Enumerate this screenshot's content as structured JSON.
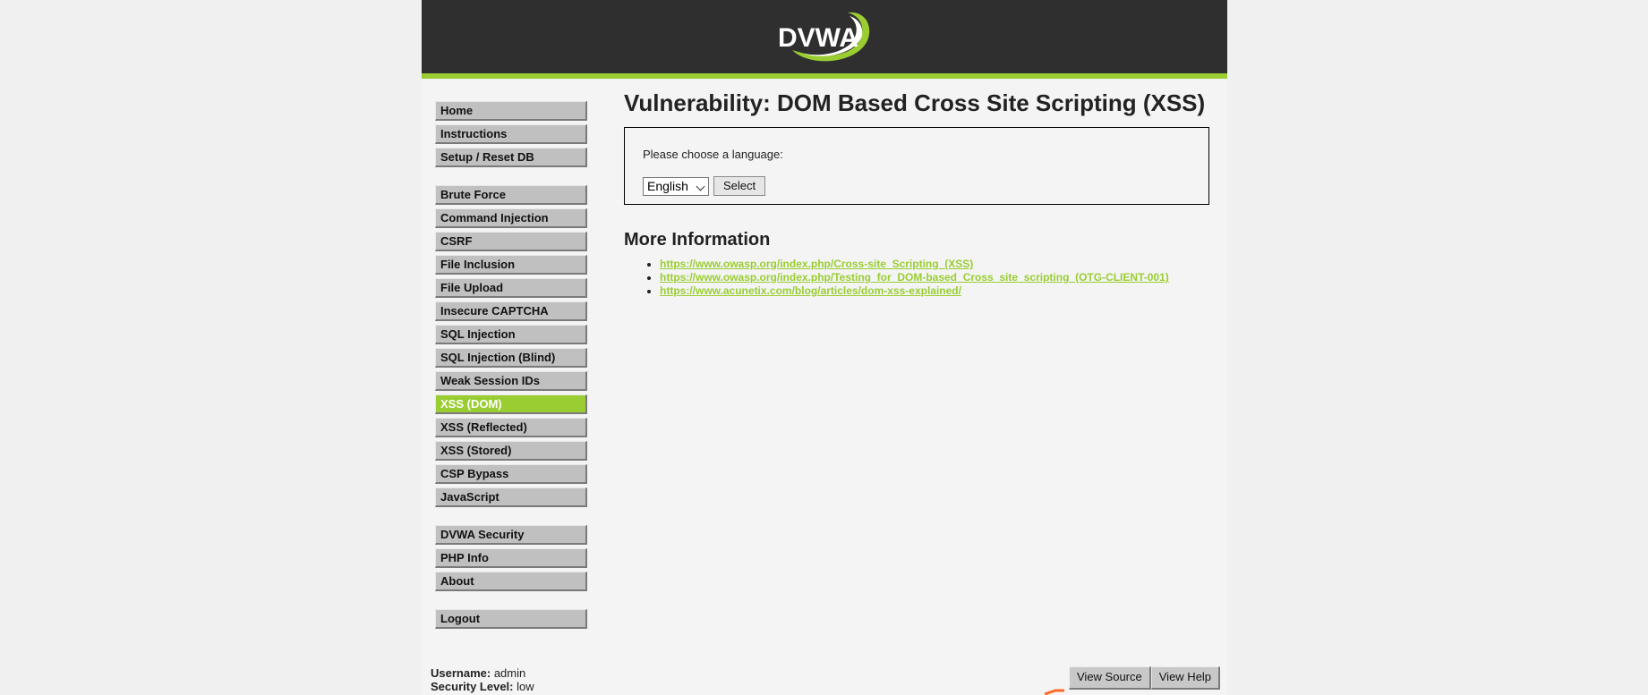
{
  "header": {
    "logo_text": "DVWA",
    "accent_color": "#9acd32",
    "background_color": "#2f2f2f"
  },
  "nav": {
    "groups": [
      {
        "items": [
          {
            "label": "Home"
          },
          {
            "label": "Instructions"
          },
          {
            "label": "Setup / Reset DB"
          }
        ]
      },
      {
        "items": [
          {
            "label": "Brute Force"
          },
          {
            "label": "Command Injection"
          },
          {
            "label": "CSRF"
          },
          {
            "label": "File Inclusion"
          },
          {
            "label": "File Upload"
          },
          {
            "label": "Insecure CAPTCHA"
          },
          {
            "label": "SQL Injection"
          },
          {
            "label": "SQL Injection (Blind)"
          },
          {
            "label": "Weak Session IDs"
          },
          {
            "label": "XSS (DOM)",
            "selected": true
          },
          {
            "label": "XSS (Reflected)"
          },
          {
            "label": "XSS (Stored)"
          },
          {
            "label": "CSP Bypass"
          },
          {
            "label": "JavaScript"
          }
        ]
      },
      {
        "items": [
          {
            "label": "DVWA Security"
          },
          {
            "label": "PHP Info"
          },
          {
            "label": "About"
          }
        ]
      },
      {
        "items": [
          {
            "label": "Logout"
          }
        ]
      }
    ]
  },
  "main": {
    "title": "Vulnerability: DOM Based Cross Site Scripting (XSS)",
    "prompt": "Please choose a language:",
    "language_select": {
      "value": "English"
    },
    "select_button": "Select",
    "more_info_title": "More Information",
    "links": [
      "https://www.owasp.org/index.php/Cross-site_Scripting_(XSS)",
      "https://www.owasp.org/index.php/Testing_for_DOM-based_Cross_site_scripting_(OTG-CLIENT-001)",
      "https://www.acunetix.com/blog/articles/dom-xss-explained/"
    ]
  },
  "footer": {
    "username_label": "Username:",
    "username": "admin",
    "security_label": "Security Level:",
    "security": "low",
    "view_source": "View Source",
    "view_help": "View Help"
  }
}
